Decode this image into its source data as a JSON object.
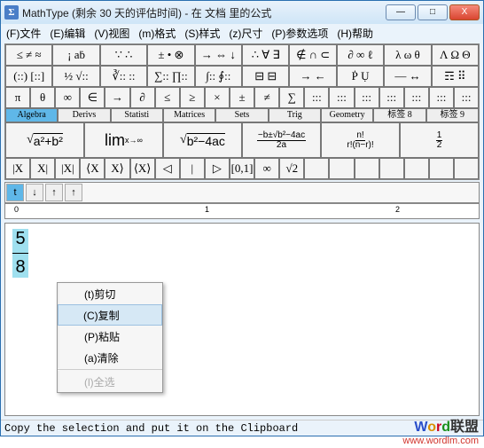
{
  "title": "MathType (剩余 30 天的评估时间) - 在 文档 里的公式",
  "menus": [
    "(F)文件",
    "(E)编辑",
    "(V)视图",
    "(m)格式",
    "(S)样式",
    "(z)尺寸",
    "(P)参数选项",
    "(H)帮助"
  ],
  "winbtns": {
    "min": "—",
    "max": "□",
    "close": "X"
  },
  "palette": {
    "r1": [
      "≤ ≠ ≈",
      "¡ aḃ",
      "∵ ∴",
      "± • ⊗",
      "→ ⇔ ↓",
      "∴ ∀ ∃",
      "∉ ∩ ⊂",
      "∂ ∞ ℓ",
      "λ ω θ",
      "Λ Ω Θ"
    ],
    "r2": [
      "(::) [::]",
      "½ √::",
      "∛:: ::",
      "∑:: ∏::",
      "∫:: ∮::",
      "⊟ ⊟",
      "→ ←",
      "Ṗ Ụ",
      "— ↔",
      "☶ ⠿"
    ],
    "r3": [
      "π",
      "θ",
      "∞",
      "∈",
      "→",
      "∂",
      "≤",
      "≥",
      "×",
      "±",
      "≠",
      "∑",
      ":::",
      ":::",
      ":::",
      ":::",
      ":::",
      ":::",
      ":::"
    ]
  },
  "tabs": [
    "Algebra",
    "Derivs",
    "Statisti",
    "Matrices",
    "Sets",
    "Trig",
    "Geometry",
    "标签 8",
    "标签 9"
  ],
  "tabActive": 0,
  "bigrow_alt": [
    "sqrt(a^2+b^2)",
    "lim x→∞",
    "sqrt(b^2-4ac)",
    "quadratic",
    "n!/r!(n-r)!",
    "1/2"
  ],
  "r4": [
    "|X",
    "X|",
    "|X|",
    "⟨X",
    "X⟩",
    "⟨X⟩",
    "◁",
    "|",
    "▷",
    "[0,1]",
    "∞",
    "√2",
    "",
    "",
    "",
    "",
    "",
    "",
    ""
  ],
  "tinybar": [
    "t",
    "↓",
    "↑",
    "↑"
  ],
  "rulermarks": [
    {
      "p": 10,
      "t": "0"
    },
    {
      "p": 225,
      "t": "1"
    },
    {
      "p": 440,
      "t": "2"
    }
  ],
  "fraction": {
    "num": "5",
    "den": "8"
  },
  "context": [
    {
      "k": "cut",
      "label": "(t)剪切",
      "sel": false
    },
    {
      "k": "copy",
      "label": "(C)复制",
      "sel": true
    },
    {
      "k": "paste",
      "label": "(P)粘贴",
      "sel": false
    },
    {
      "k": "clear",
      "label": "(a)清除",
      "sel": false
    }
  ],
  "contextDisabled": "(l)全选",
  "status": "Copy the selection and put it on the Clipboard",
  "watermark": {
    "brand_w": "W",
    "brand_o": "o",
    "brand_r": "r",
    "brand_d": "d",
    "brand_cn": "联盟",
    "url": "www.wordlm.com"
  }
}
